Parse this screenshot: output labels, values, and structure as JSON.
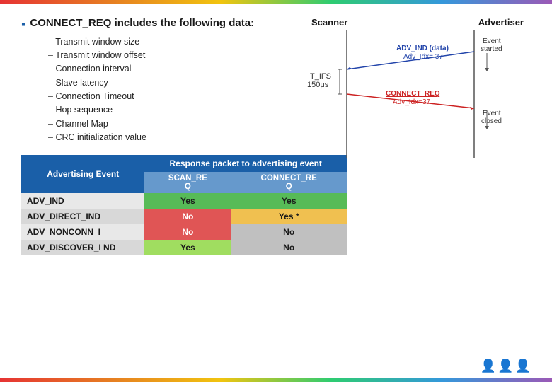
{
  "topBar": {
    "label": "rainbow-top-bar"
  },
  "mainTitle": "CONNECT_REQ includes the following data:",
  "bulletItems": [
    "Transmit window size",
    "Transmit window offset",
    "Connection interval",
    "Slave latency",
    "Connection Timeout",
    "Hop sequence",
    "Channel Map",
    "CRC initialization value"
  ],
  "diagram": {
    "scanner_label": "Scanner",
    "advertiser_label": "Advertiser",
    "tifs_label": "T_IFS",
    "tifs_value": "150μs",
    "adv_ind_label": "ADV_IND (data)",
    "adv_idx_label": "Adv_Idx= 37",
    "connect_req_label": "CONNECT_REQ",
    "connect_adv_idx": "Adv_Idx=37",
    "event_started": "Event started",
    "event_closed": "Event closed"
  },
  "table": {
    "header_col1": "Advertising Event",
    "header_col2": "Response packet to advertising event",
    "subheader_col1": "SCAN_RE",
    "subheader_col2": "CONNECT_RE",
    "rows": [
      {
        "event": "ADV_IND",
        "scan": "Yes",
        "connect": "Yes",
        "scan_color": "green",
        "connect_color": "green"
      },
      {
        "event": "ADV_DIRECT_IND",
        "scan": "No",
        "connect": "Yes *",
        "scan_color": "red",
        "connect_color": "yellow"
      },
      {
        "event": "ADV_NONCONN_I",
        "scan": "No",
        "connect": "No",
        "scan_color": "red",
        "connect_color": "gray"
      },
      {
        "event": "ADV_DISCOVER_I ND",
        "scan": "Yes",
        "connect": "No",
        "scan_color": "lime",
        "connect_color": "gray"
      }
    ]
  }
}
